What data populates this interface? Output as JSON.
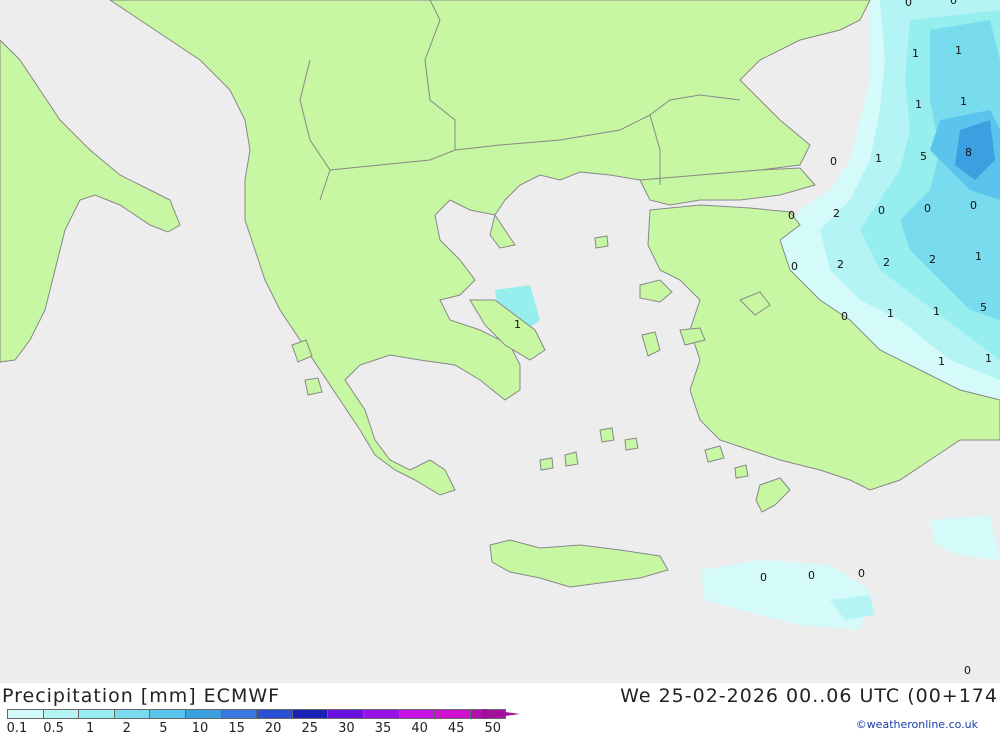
{
  "map": {
    "sea_color": "#ededed",
    "land_color": "#c7f7a2",
    "coast_color": "#888888",
    "values": [
      "0",
      "0",
      "1",
      "1",
      "1",
      "1",
      "0",
      "1",
      "5",
      "8",
      "0",
      "2",
      "0",
      "0",
      "0",
      "0",
      "2",
      "2",
      "2",
      "1",
      "1",
      "0",
      "1",
      "1",
      "5",
      "1",
      "1",
      "0",
      "0",
      "0",
      "0"
    ]
  },
  "footer": {
    "title": "Precipitation [mm] ECMWF",
    "datetime": "We 25-02-2026 00..06 UTC (00+174",
    "credit": "©weatheronline.co.uk",
    "scale_labels": [
      "0.1",
      "0.5",
      "1",
      "2",
      "5",
      "10",
      "15",
      "20",
      "25",
      "30",
      "35",
      "40",
      "45",
      "50"
    ],
    "scale_colors": [
      "#d4fafa",
      "#b4f4f4",
      "#96eeee",
      "#78dcee",
      "#5ac4ec",
      "#3ca0e0",
      "#3a78e0",
      "#2a50d8",
      "#1a20b8",
      "#6a10e0",
      "#9a10e8",
      "#c810e8",
      "#d010d0",
      "#b010b0"
    ]
  }
}
